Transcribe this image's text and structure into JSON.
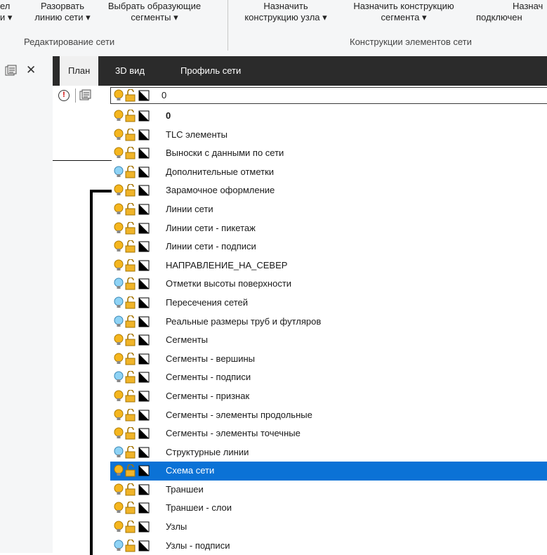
{
  "ribbon": {
    "buttons": [
      {
        "line1": "ел",
        "line2": "и ▾"
      },
      {
        "line1": "Разорвать",
        "line2": "линию сети ▾"
      },
      {
        "line1": "Выбрать образующие",
        "line2": "сегменты ▾"
      },
      {
        "line1": "Назначить",
        "line2": "конструкцию узла ▾"
      },
      {
        "line1": "Назначить конструкцию",
        "line2": "сегмента ▾"
      },
      {
        "line1": "Назнач",
        "line2": "подключен"
      }
    ],
    "groups": [
      "Редактирование сети",
      "Конструкции элементов сети"
    ]
  },
  "tabs": [
    "План",
    "3D вид",
    "Профиль сети"
  ],
  "layer_combo": {
    "value": "0"
  },
  "colors": {
    "bulb_on": "#f5b61f",
    "bulb_off": "#8fd3f5",
    "lock": "#f0b429",
    "selected": "#0b72d6"
  },
  "layers": [
    {
      "name": "0",
      "bulb": "on",
      "bold": true
    },
    {
      "name": "TLC элементы",
      "bulb": "on"
    },
    {
      "name": "Выноски с данными по сети",
      "bulb": "on"
    },
    {
      "name": "Дополнительные отметки",
      "bulb": "off"
    },
    {
      "name": "Зарамочное оформление",
      "bulb": "on"
    },
    {
      "name": "Линии сети",
      "bulb": "on"
    },
    {
      "name": "Линии сети - пикетаж",
      "bulb": "on"
    },
    {
      "name": "Линии сети - подписи",
      "bulb": "on"
    },
    {
      "name": "НАПРАВЛЕНИЕ_НА_СЕВЕР",
      "bulb": "on"
    },
    {
      "name": "Отметки высоты поверхности",
      "bulb": "off"
    },
    {
      "name": "Пересечения сетей",
      "bulb": "off"
    },
    {
      "name": "Реальные размеры труб и футляров",
      "bulb": "off"
    },
    {
      "name": "Сегменты",
      "bulb": "on"
    },
    {
      "name": "Сегменты - вершины",
      "bulb": "on"
    },
    {
      "name": "Сегменты - подписи",
      "bulb": "off"
    },
    {
      "name": "Сегменты - признак",
      "bulb": "on"
    },
    {
      "name": "Сегменты - элементы продольные",
      "bulb": "on"
    },
    {
      "name": "Сегменты - элементы точечные",
      "bulb": "on"
    },
    {
      "name": "Структурные линии",
      "bulb": "off"
    },
    {
      "name": "Схема сети",
      "bulb": "on",
      "selected": true
    },
    {
      "name": "Траншеи",
      "bulb": "on"
    },
    {
      "name": "Траншеи - слои",
      "bulb": "on"
    },
    {
      "name": "Узлы",
      "bulb": "on"
    },
    {
      "name": "Узлы - подписи",
      "bulb": "off"
    }
  ]
}
